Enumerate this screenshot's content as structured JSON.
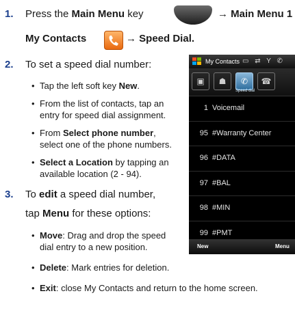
{
  "step1": {
    "number": "1.",
    "press": "Press the ",
    "main_menu_key": "Main Menu",
    "key_word": " key",
    "arrow1": "→ Main Menu 1 →",
    "my_contacts": "My Contacts",
    "arrow2": "→ Speed Dial."
  },
  "step2": {
    "number": "2.",
    "text": "To set a speed dial number:",
    "bullets": [
      {
        "a": "Tap the left soft key ",
        "b": "New",
        "c": "."
      },
      {
        "a": "From the list of contacts, tap an",
        "b": "",
        "c": ""
      },
      {
        "a": "entry for speed dial assignment.",
        "b": "",
        "c": ""
      },
      {
        "a": "From ",
        "b": "Select phone number",
        "c": ","
      },
      {
        "a": "select one of the phone numbers.",
        "b": "",
        "c": ""
      },
      {
        "a": "",
        "b": "Select a Location",
        "c": " by tapping an"
      },
      {
        "a": "available location (2 - 94).",
        "b": "",
        "c": ""
      }
    ]
  },
  "step3": {
    "number": "3.",
    "line1_a": "To ",
    "line1_b": "edit",
    "line1_c": " a speed dial number,",
    "line2_a": "tap ",
    "line2_b": "Menu",
    "line2_c": " for these options:",
    "move_label": "Move",
    "move_text": ": Drag and drop the speed",
    "move_text2": "dial entry to a new position.",
    "delete_label": "Delete",
    "delete_text": ": Mark entries for deletion.",
    "exit_label": "Exit",
    "exit_text": ": close My Contacts and return to the home screen."
  },
  "phone": {
    "title": "My Contacts",
    "tab_label": "Speed dial",
    "rows": [
      {
        "n": "1",
        "name": "Voicemail"
      },
      {
        "n": "95",
        "name": "#Warranty Center"
      },
      {
        "n": "96",
        "name": "#DATA"
      },
      {
        "n": "97",
        "name": "#BAL"
      },
      {
        "n": "98",
        "name": "#MIN"
      },
      {
        "n": "99",
        "name": "#PMT"
      }
    ],
    "left_soft": "New",
    "right_soft": "Menu"
  },
  "icons": [
    "main-menu-key-icon",
    "my-contacts-icon",
    "windows-flag-icon"
  ]
}
